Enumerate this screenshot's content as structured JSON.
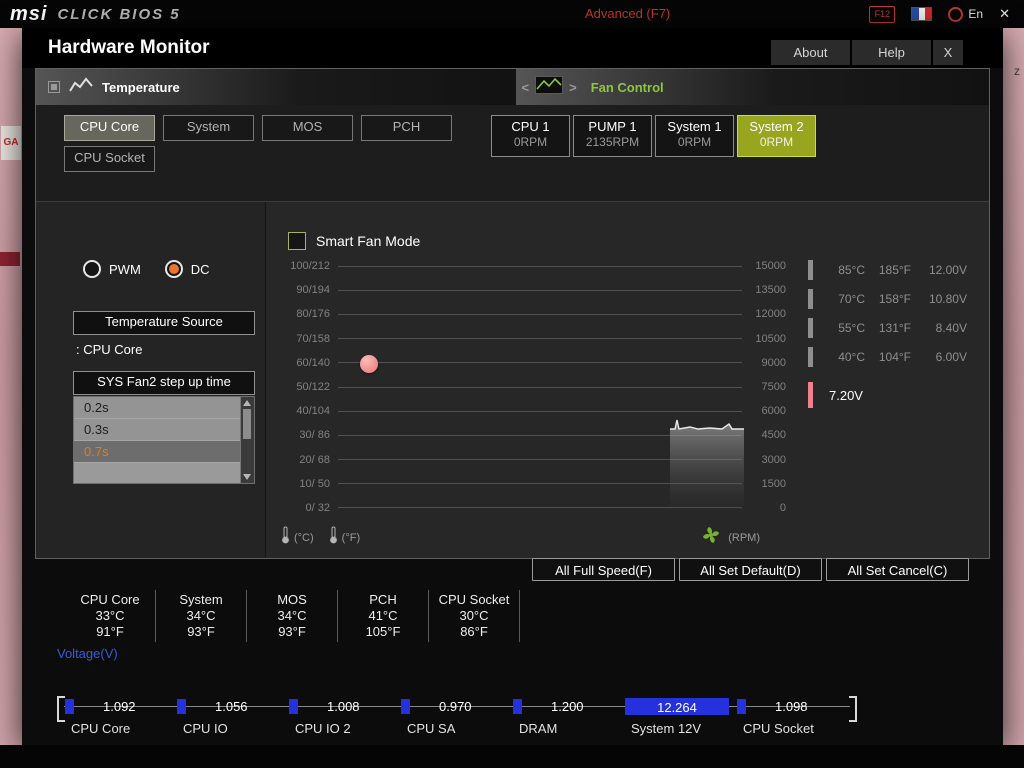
{
  "top_bar": {
    "logo": "msi",
    "logo_text": "CLICK BIOS 5",
    "advanced_label": "Advanced (F7)",
    "f12_label": "F12",
    "language_label": "En",
    "close_label": "✕"
  },
  "background": {
    "left_partial_text": "GA",
    "right_partial_text": "z"
  },
  "window": {
    "title": "Hardware Monitor",
    "about_label": "About",
    "help_label": "Help",
    "close_label": "X"
  },
  "temperature_section": {
    "title": "Temperature",
    "tabs": [
      {
        "label": "CPU Core",
        "active": true
      },
      {
        "label": "System"
      },
      {
        "label": "MOS"
      },
      {
        "label": "PCH"
      },
      {
        "label": "CPU Socket"
      }
    ]
  },
  "fan_section": {
    "title": "Fan Control",
    "fans": [
      {
        "name": "CPU 1",
        "rpm": "0RPM"
      },
      {
        "name": "PUMP 1",
        "rpm": "2135RPM"
      },
      {
        "name": "System 1",
        "rpm": "0RPM"
      },
      {
        "name": "System 2",
        "rpm": "0RPM",
        "active": true
      }
    ]
  },
  "control_panel": {
    "pwm_label": "PWM",
    "dc_label": "DC",
    "selected_mode": "DC",
    "temp_source_button": "Temperature Source",
    "temp_source_value": ": CPU Core",
    "step_time_button": "SYS Fan2 step up time",
    "step_options": [
      {
        "label": "0.2s"
      },
      {
        "label": "0.3s"
      },
      {
        "label": "0.7s",
        "active": true
      }
    ]
  },
  "fan_chart": {
    "smart_fan_label": "Smart Fan Mode",
    "axis_rows": [
      {
        "temp": "100/212",
        "rpm": "15000"
      },
      {
        "temp": "90/194",
        "rpm": "13500"
      },
      {
        "temp": "80/176",
        "rpm": "12000"
      },
      {
        "temp": "70/158",
        "rpm": "10500"
      },
      {
        "temp": "60/140",
        "rpm": "9000"
      },
      {
        "temp": "50/122",
        "rpm": "7500"
      },
      {
        "temp": "40/104",
        "rpm": "6000"
      },
      {
        "temp": "30/ 86",
        "rpm": "4500"
      },
      {
        "temp": "20/ 68",
        "rpm": "3000"
      },
      {
        "temp": "10/ 50",
        "rpm": "1500"
      },
      {
        "temp": "0/ 32",
        "rpm": "0"
      }
    ],
    "celsius_label": "(°C)",
    "fahrenheit_label": "(°F)",
    "rpm_label": "(RPM)",
    "duty_levels": [
      {
        "c": "85°C",
        "f": "185°F",
        "v": "12.00V"
      },
      {
        "c": "70°C",
        "f": "158°F",
        "v": "10.80V"
      },
      {
        "c": "55°C",
        "f": "131°F",
        "v": "8.40V"
      },
      {
        "c": "40°C",
        "f": "104°F",
        "v": "6.00V"
      }
    ],
    "current_voltage": "7.20V"
  },
  "actions": [
    {
      "label": "All Full Speed(F)"
    },
    {
      "label": "All Set Default(D)"
    },
    {
      "label": "All Set Cancel(C)"
    }
  ],
  "temperatures": [
    {
      "name": "CPU Core",
      "celsius": "33°C",
      "fahrenheit": "91°F"
    },
    {
      "name": "System",
      "celsius": "34°C",
      "fahrenheit": "93°F"
    },
    {
      "name": "MOS",
      "celsius": "34°C",
      "fahrenheit": "93°F"
    },
    {
      "name": "PCH",
      "celsius": "41°C",
      "fahrenheit": "105°F"
    },
    {
      "name": "CPU Socket",
      "celsius": "30°C",
      "fahrenheit": "86°F"
    }
  ],
  "voltage": {
    "label": "Voltage(V)",
    "items": [
      {
        "name": "CPU Core",
        "value": "1.092"
      },
      {
        "name": "CPU IO",
        "value": "1.056"
      },
      {
        "name": "CPU IO 2",
        "value": "1.008"
      },
      {
        "name": "CPU SA",
        "value": "0.970"
      },
      {
        "name": "DRAM",
        "value": "1.200"
      },
      {
        "name": "System 12V",
        "value": "12.264",
        "highlight": true
      },
      {
        "name": "CPU Socket",
        "value": "1.098"
      }
    ]
  },
  "colors": {
    "accent_green": "#8dc63f",
    "active_fan_bg": "#97a51f",
    "selected_option_text": "#e57a1d",
    "voltage_bar_blue": "#2531dd",
    "current_voltage_pink": "#ef8090",
    "advanced_red": "#c43a2e",
    "voltage_label_blue": "#3b5bd6"
  }
}
